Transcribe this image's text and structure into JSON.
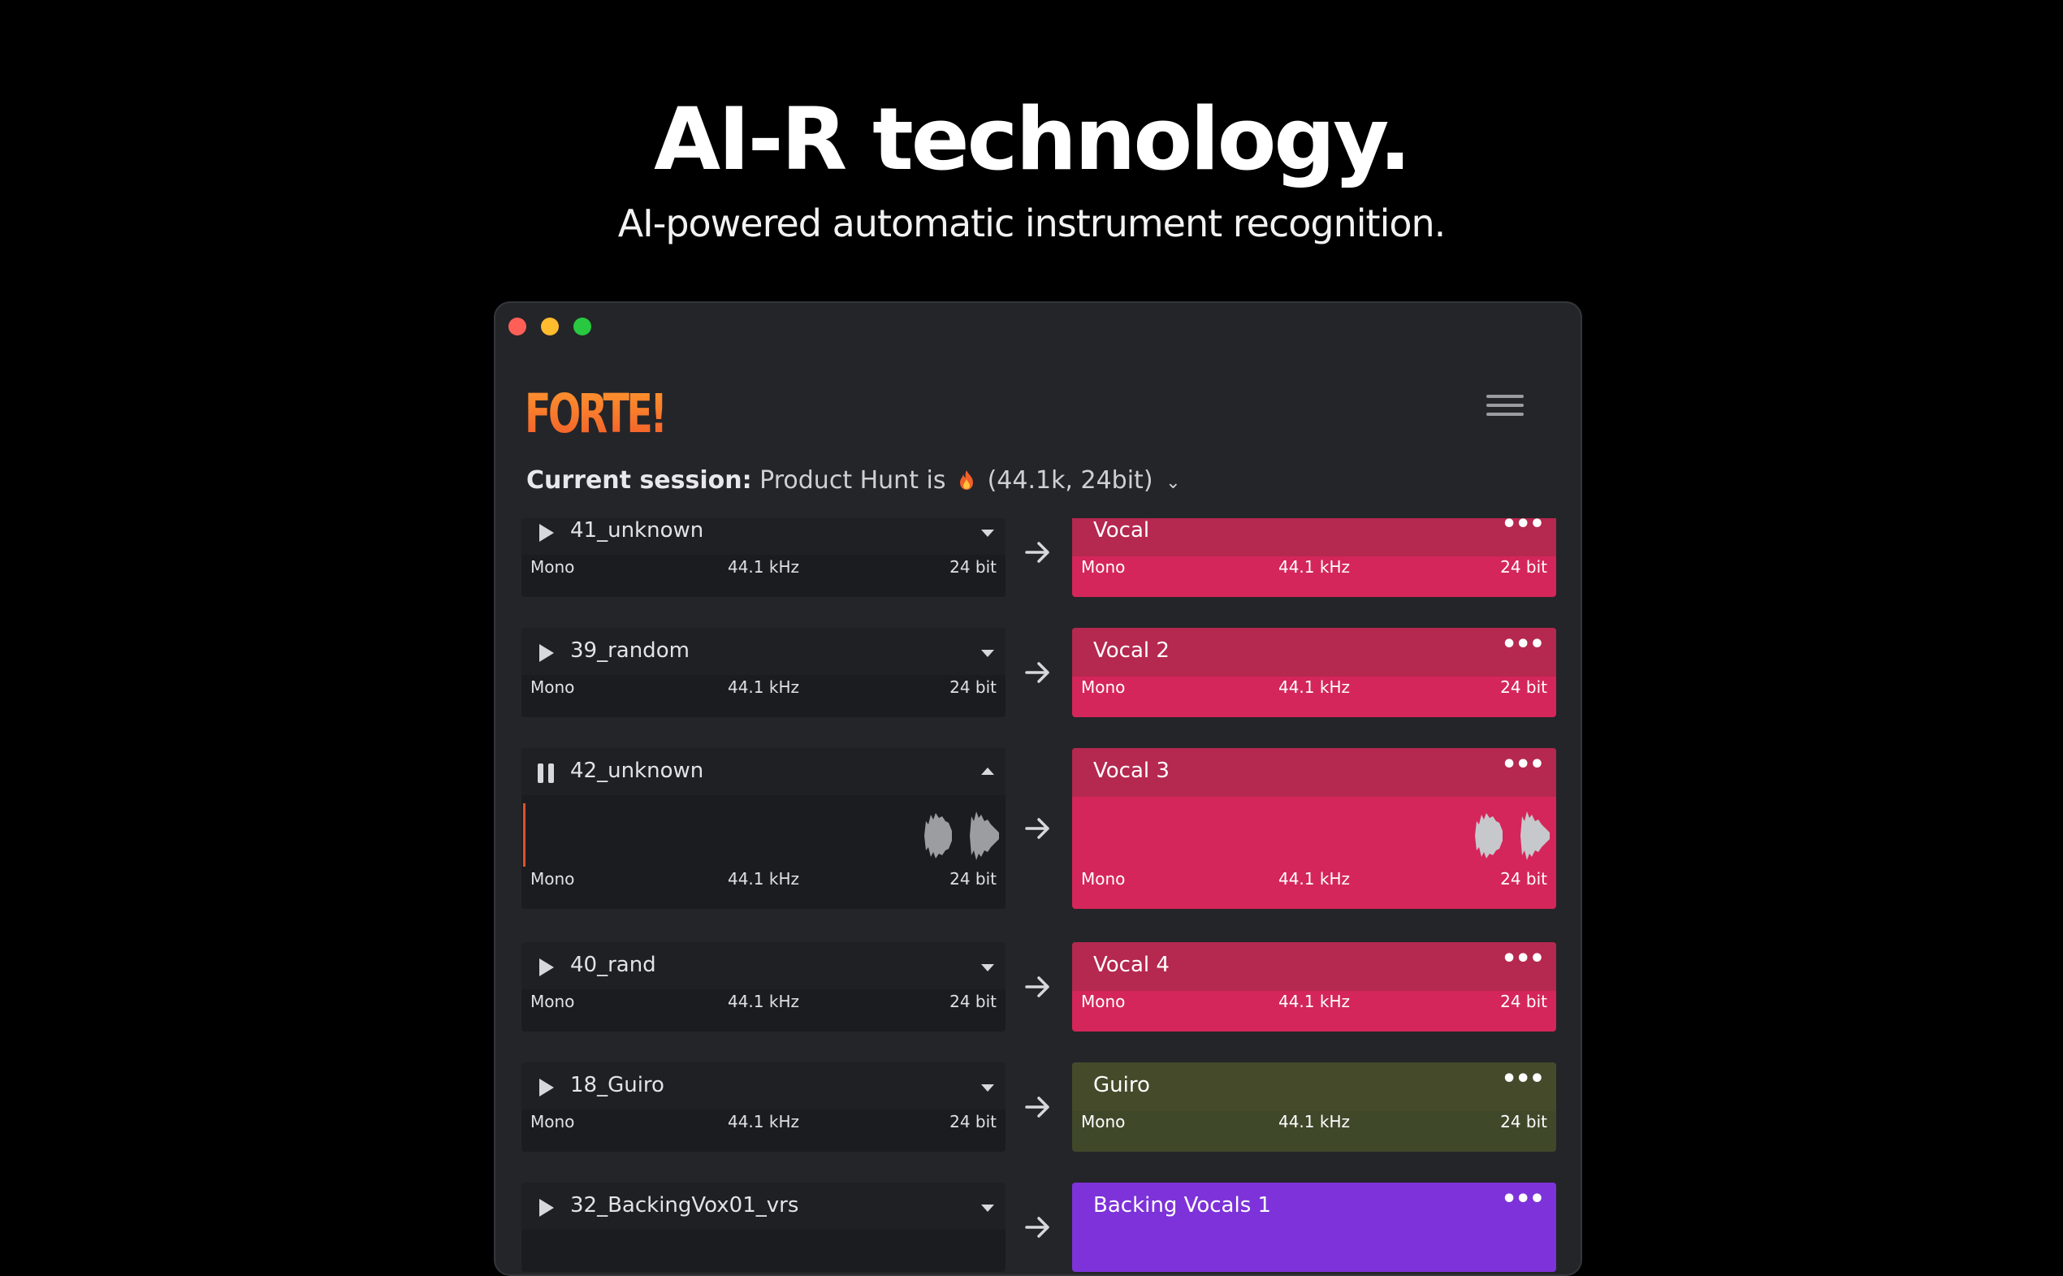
{
  "hero": {
    "title": "AI-R technology.",
    "subtitle": "AI-powered automatic instrument recognition."
  },
  "app": {
    "logo": "FORTE!",
    "session_label": "Current session:",
    "session_name": "Product Hunt is",
    "session_emoji": "fire-icon",
    "session_format": "(44.1k, 24bit)"
  },
  "colors": {
    "vocal": "#d4265a",
    "vocal_head": "#b5284f",
    "guiro": "#40482a",
    "guiro_head": "#454a2b",
    "backing": "#7d33d9",
    "source": "#1b1c1f",
    "logo_orange": "#f07a2a"
  },
  "tracks": [
    {
      "source": "41_unknown",
      "target": "Vocal",
      "channels": "Mono",
      "rate": "44.1 kHz",
      "depth": "24 bit",
      "state": "stopped"
    },
    {
      "source": "39_random",
      "target": "Vocal 2",
      "channels": "Mono",
      "rate": "44.1 kHz",
      "depth": "24 bit",
      "state": "stopped"
    },
    {
      "source": "42_unknown",
      "target": "Vocal 3",
      "channels": "Mono",
      "rate": "44.1 kHz",
      "depth": "24 bit",
      "state": "playing"
    },
    {
      "source": "40_rand",
      "target": "Vocal 4",
      "channels": "Mono",
      "rate": "44.1 kHz",
      "depth": "24 bit",
      "state": "stopped"
    },
    {
      "source": "18_Guiro",
      "target": "Guiro",
      "channels": "Mono",
      "rate": "44.1 kHz",
      "depth": "24 bit",
      "state": "stopped"
    },
    {
      "source": "32_BackingVox01_vrs",
      "target": "Backing Vocals 1",
      "channels": "",
      "rate": "",
      "depth": "",
      "state": "stopped"
    }
  ]
}
